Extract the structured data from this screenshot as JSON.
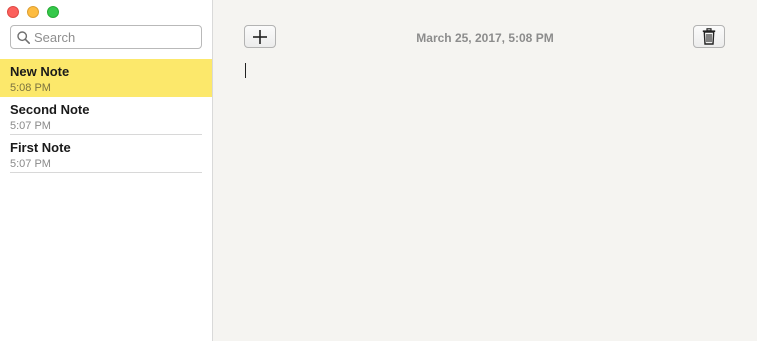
{
  "window": {
    "controls": [
      "close",
      "minimize",
      "zoom"
    ]
  },
  "search": {
    "placeholder": "Search",
    "value": ""
  },
  "notes": [
    {
      "title": "New Note",
      "time": "5:08 PM",
      "selected": true
    },
    {
      "title": "Second Note",
      "time": "5:07 PM",
      "selected": false
    },
    {
      "title": "First Note",
      "time": "5:07 PM",
      "selected": false
    }
  ],
  "editor": {
    "date": "March 25, 2017, 5:08 PM",
    "body": ""
  },
  "icons": {
    "new_note": "plus-icon",
    "delete": "trash-icon",
    "search": "search-icon"
  },
  "colors": {
    "selected_note": "#fce86b",
    "close": "#fc605c",
    "minimize": "#fdbc40",
    "zoom": "#34c84a"
  }
}
